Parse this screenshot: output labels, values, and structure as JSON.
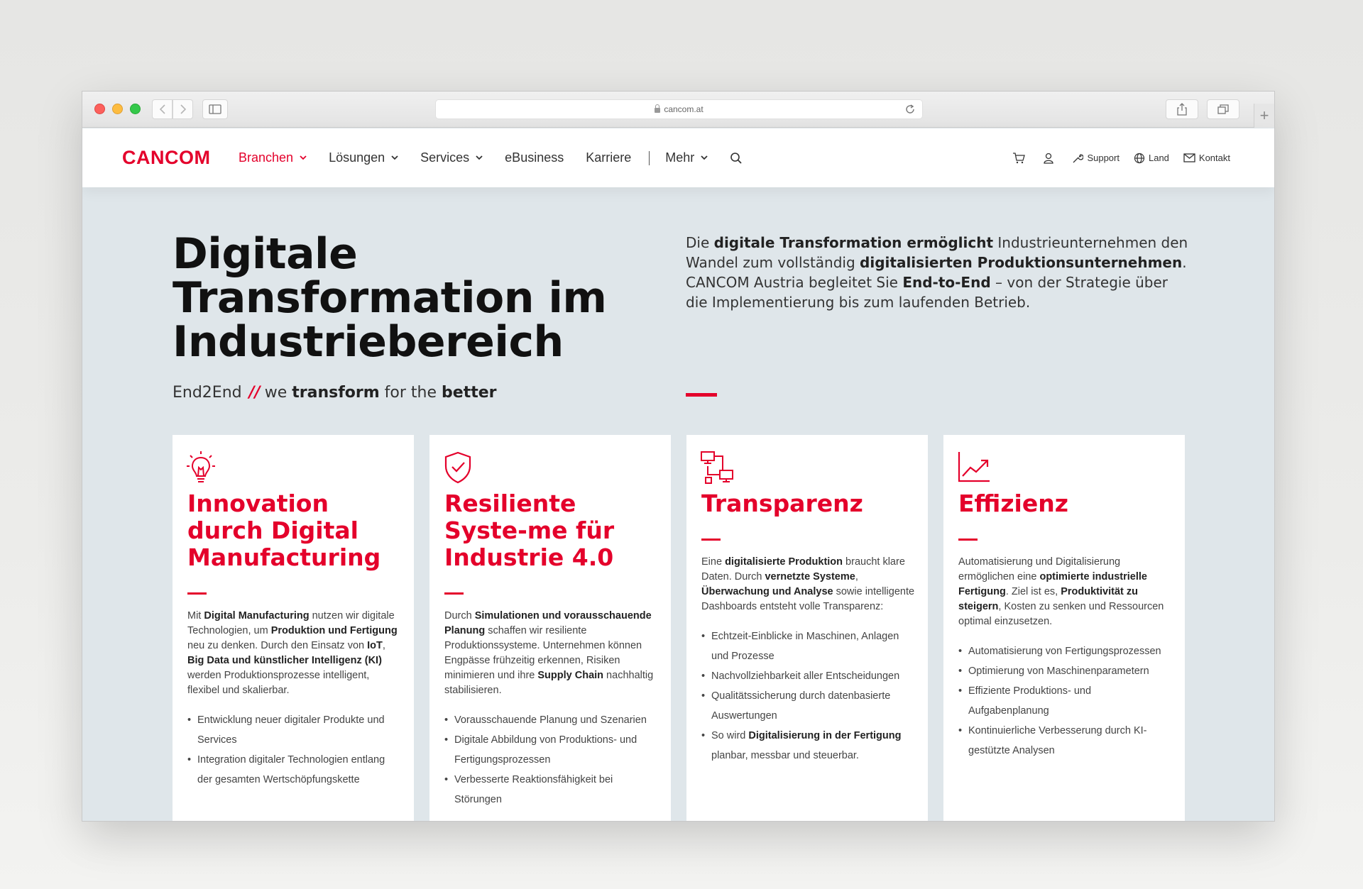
{
  "browser": {
    "url": "cancom.at"
  },
  "nav": {
    "logo": "CANCOM",
    "items": [
      {
        "label": "Branchen"
      },
      {
        "label": "Lösungen"
      },
      {
        "label": "Services"
      },
      {
        "label": "eBusiness"
      },
      {
        "label": "Karriere"
      },
      {
        "label": "Mehr"
      }
    ],
    "util": {
      "support": "Support",
      "land": "Land",
      "kontakt": "Kontakt"
    }
  },
  "hero": {
    "title_l1": "Digitale",
    "title_l2": "Transformation im",
    "title_l3": "Industriebereich",
    "slogan": {
      "a": "End2End",
      "slash": "//",
      "b": "we",
      "c": "transform",
      "d": "for the",
      "e": "better"
    },
    "intro": {
      "p1": "Die ",
      "b1": "digitale Transformation ermöglicht",
      "p2": " Industrieunternehmen den Wandel zum vollständig ",
      "b2": "digitalisierten Produktionsunternehmen",
      "p3": ". CANCOM Austria begleitet Sie ",
      "b3": "End-to-End",
      "p4": " – von der Strategie über die Implementierung bis zum laufenden Betrieb."
    }
  },
  "cards": [
    {
      "icon": "lightbulb-icon",
      "title": "Innovation durch Digital Manufacturing",
      "t": [
        "Mit ",
        "Digital Manufacturing",
        " nutzen wir digitale Technologien, um ",
        "Produktion und Fertigung",
        " neu zu denken. Durch den Einsatz von ",
        "IoT",
        ", ",
        "Big Data und künstlicher Intelligenz (KI)",
        " werden Produktionsprozesse intelligent, flexibel und skalierbar."
      ],
      "bullets": [
        "Entwicklung neuer digitaler Produkte und Services",
        "Integration digitaler Technologien entlang der gesamten Wertschöpfungskette"
      ]
    },
    {
      "icon": "shield-check-icon",
      "title": "Resiliente Syste-me für Industrie 4.0",
      "t": [
        "Durch ",
        "Simulationen und vorausschauende Planung",
        " schaffen wir resiliente Produktionssysteme. Unternehmen können Engpässe frühzeitig erkennen, Risiken minimieren und ihre ",
        "Supply Chain",
        " nachhaltig stabilisieren."
      ],
      "bullets": [
        "Vorausschauende Planung und Szenarien",
        "Digitale Abbildung von Produktions- und Fertigungsprozessen",
        "Verbesserte Reaktionsfähigkeit bei Störungen"
      ]
    },
    {
      "icon": "network-devices-icon",
      "title": "Transparenz",
      "t": [
        "Eine ",
        "digitalisierte Produktion",
        " braucht klare Daten. Durch ",
        "vernetzte Systeme",
        ", ",
        "Überwachung und Analyse",
        " sowie intelligente Dashboards entsteht volle Transparenz:"
      ],
      "bullets": [
        "Echtzeit-Einblicke in Maschinen, Anlagen und Prozesse",
        "Nachvollziehbarkeit aller Entscheidungen",
        "Qualitätssicherung durch datenbasierte Auswertungen"
      ],
      "last_bullet": {
        "a": "So wird ",
        "b": "Digitalisierung in der Fertigung",
        "c": " planbar, messbar und steuerbar."
      }
    },
    {
      "icon": "trending-chart-icon",
      "title": "Effizienz",
      "t": [
        "Automatisierung und Digitalisierung ermöglichen eine ",
        "optimierte industrielle Fertigung",
        ". Ziel ist es, ",
        "Produktivität zu steigern",
        ", Kosten zu senken und Ressourcen optimal einzusetzen."
      ],
      "bullets": [
        "Automatisierung von Fertigungsprozessen",
        "Optimierung von Maschinenparametern",
        "Effiziente Produktions- und Aufgabenplanung",
        "Kontinuierliche Verbesserung durch KI-gestützte Analysen"
      ]
    }
  ]
}
